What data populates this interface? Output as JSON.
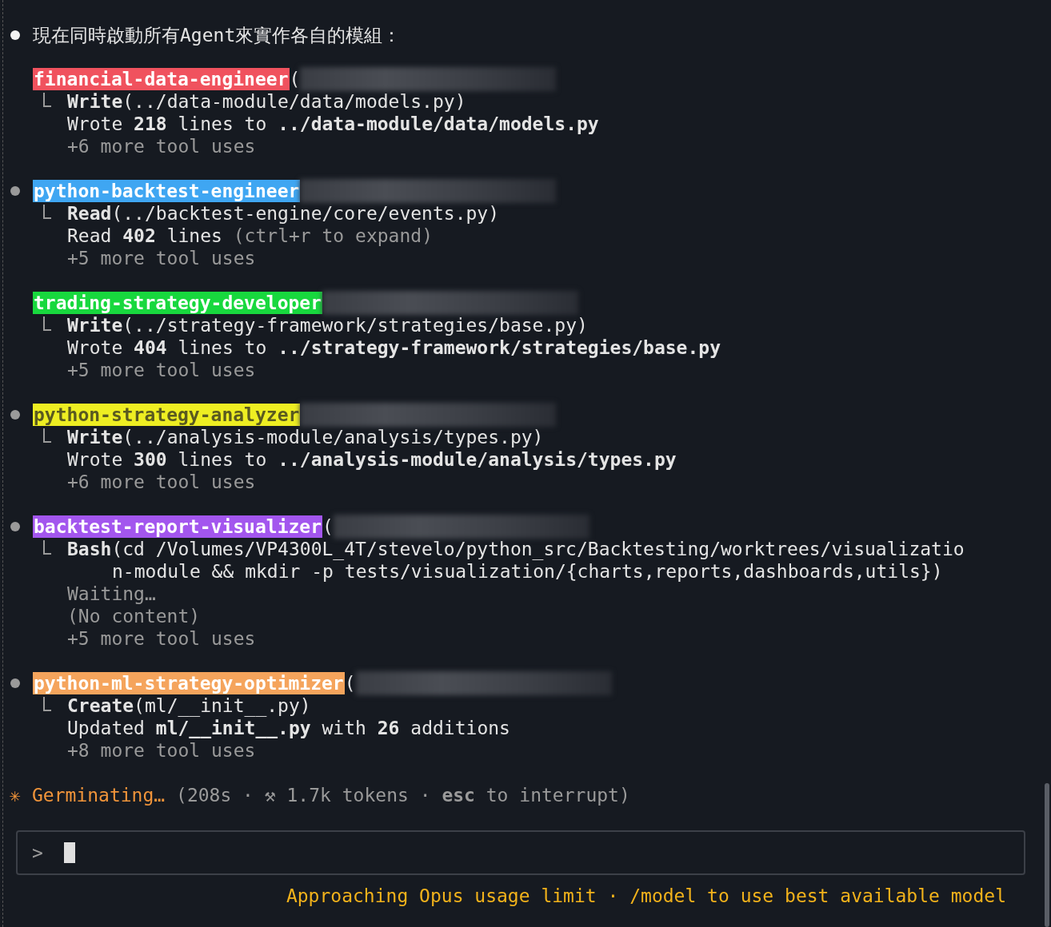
{
  "message": {
    "text": "現在同時啟動所有Agent來實作各自的模組："
  },
  "agents": [
    {
      "name": "financial-data-engineer",
      "color": "#f0525e",
      "bullet": false,
      "paren": "(",
      "lines": [
        {
          "kind": "call",
          "text": "**Write**(../data-module/data/models.py)"
        },
        {
          "kind": "result",
          "text": "Wrote **218** lines to **../data-module/data/models.py**"
        },
        {
          "kind": "more",
          "text": "+6 more tool uses"
        }
      ]
    },
    {
      "name": "python-backtest-engineer",
      "color": "#3fa6f2",
      "bullet": true,
      "lines": [
        {
          "kind": "call",
          "text": "**Read**(../backtest-engine/core/events.py)"
        },
        {
          "kind": "result",
          "text": "Read **402** lines",
          "note": "(ctrl+r to expand)"
        },
        {
          "kind": "more",
          "text": "+5 more tool uses"
        }
      ]
    },
    {
      "name": "trading-strategy-developer",
      "color": "#18d83e",
      "bullet": false,
      "lines": [
        {
          "kind": "call",
          "text": "**Write**(../strategy-framework/strategies/base.py)"
        },
        {
          "kind": "result",
          "text": "Wrote **404** lines to **../strategy-framework/strategies/base.py**"
        },
        {
          "kind": "more",
          "text": "+5 more tool uses"
        }
      ]
    },
    {
      "name": "python-strategy-analyzer",
      "color": "#eeee22",
      "bullet": true,
      "lines": [
        {
          "kind": "call",
          "text": "**Write**(../analysis-module/analysis/types.py)"
        },
        {
          "kind": "result",
          "text": "Wrote **300** lines to **../analysis-module/analysis/types.py**"
        },
        {
          "kind": "more",
          "text": "+6 more tool uses"
        }
      ]
    },
    {
      "name": "backtest-report-visualizer",
      "color": "#a356ee",
      "bullet": true,
      "paren": "(",
      "lines": [
        {
          "kind": "call",
          "text": "**Bash**(cd /Volumes/VP4300L_4T/stevelo/python_src/Backtesting/worktrees/visualizatio"
        },
        {
          "kind": "cont",
          "text": "n-module && mkdir -p tests/visualization/{charts,reports,dashboards,utils})"
        },
        {
          "kind": "more",
          "text": "Waiting…"
        },
        {
          "kind": "more",
          "text": "(No content)"
        },
        {
          "kind": "more",
          "text": "+5 more tool uses"
        }
      ]
    },
    {
      "name": "python-ml-strategy-optimizer",
      "color": "#f5a45c",
      "bullet": true,
      "paren": "(",
      "lines": [
        {
          "kind": "call",
          "text": "**Create**(ml/__init__.py)"
        },
        {
          "kind": "result",
          "text": "Updated **ml/__init__.py** with **26** additions"
        },
        {
          "kind": "more",
          "text": "+8 more tool uses"
        }
      ]
    }
  ],
  "status": {
    "spinner": "✳",
    "verb": "Germinating…",
    "detail": "(208s · ⚒ 1.7k tokens · **esc** to interrupt)"
  },
  "prompt": {
    "symbol": ">"
  },
  "footer": {
    "text": "Approaching Opus usage limit · /model to use best available model"
  }
}
